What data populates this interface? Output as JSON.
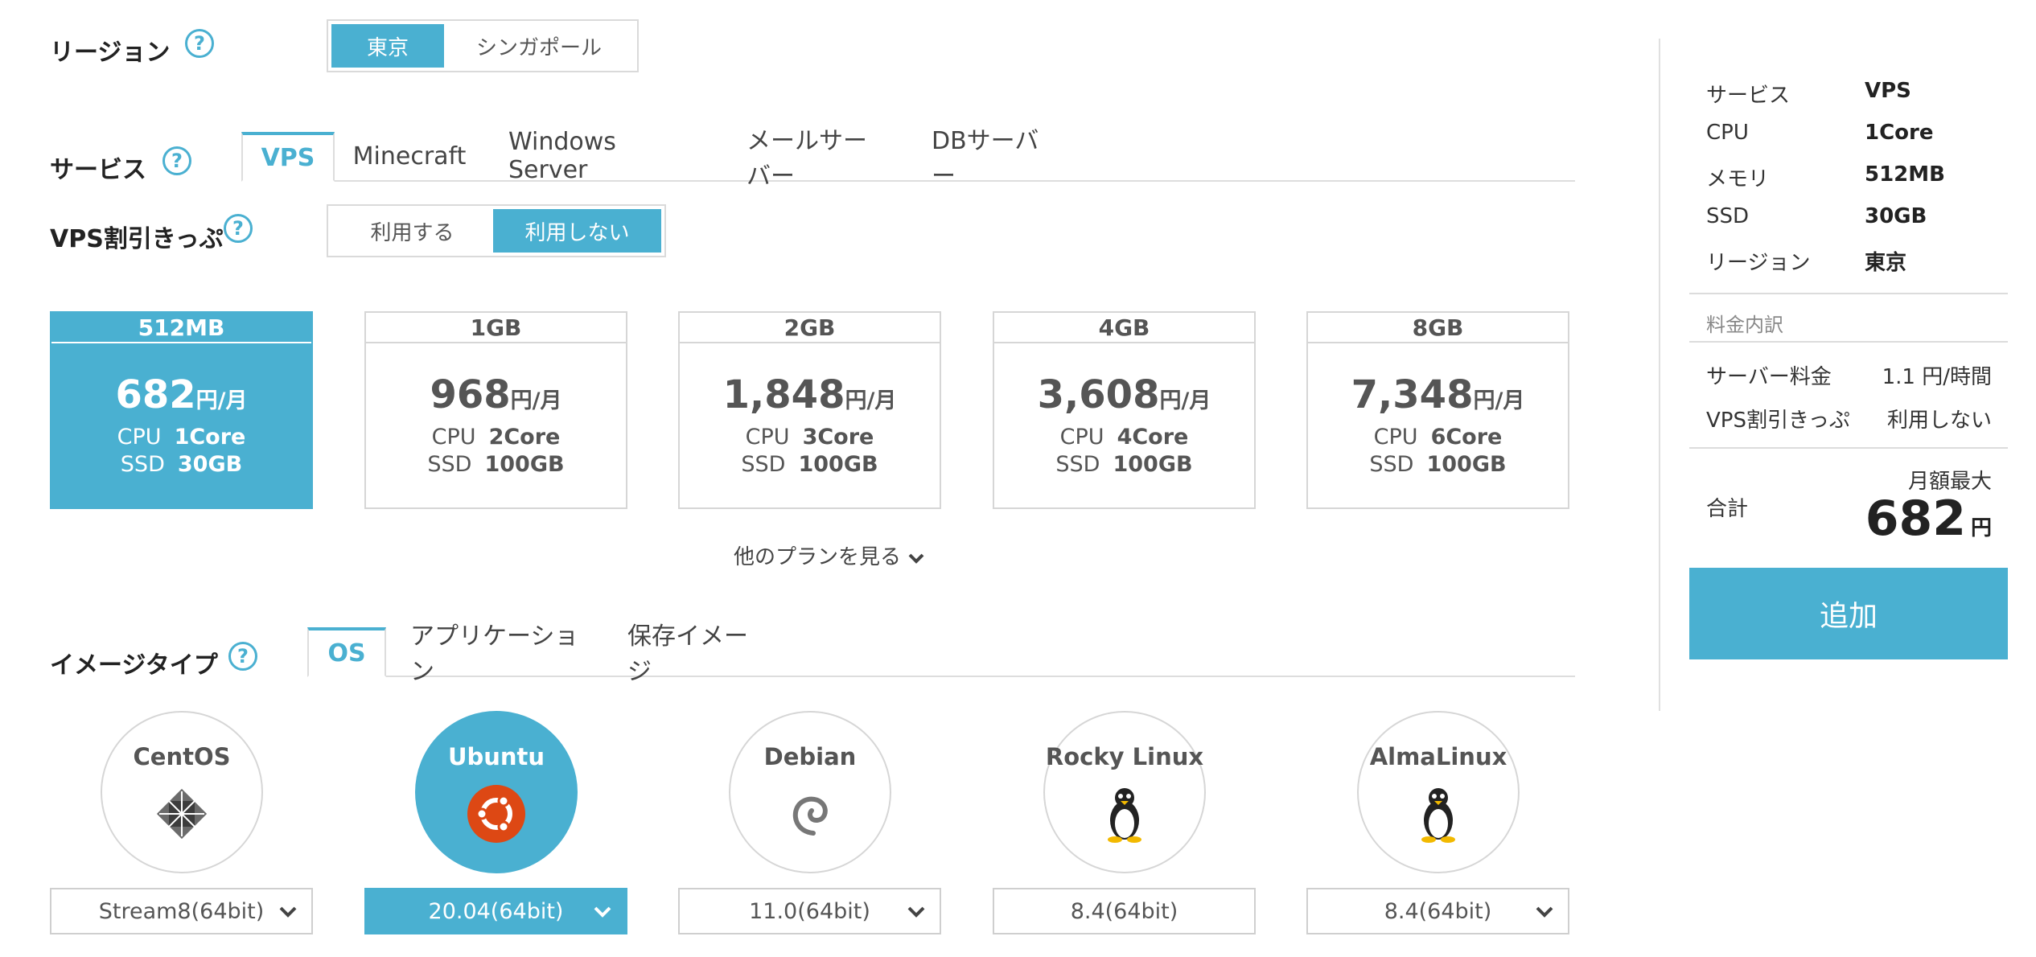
{
  "region": {
    "label": "リージョン",
    "help": "?",
    "options": [
      "東京",
      "シンガポール"
    ],
    "selected": "東京"
  },
  "service": {
    "label": "サービス",
    "help": "?",
    "tabs": [
      "VPS",
      "Minecraft",
      "Windows Server",
      "メールサーバー",
      "DBサーバー"
    ],
    "active_tab": "VPS"
  },
  "discount": {
    "label": "VPS割引きっぷ",
    "help": "?",
    "options": [
      "利用する",
      "利用しない"
    ],
    "selected": "利用しない"
  },
  "plans": [
    {
      "name": "512MB",
      "price": "682",
      "unit": "円/月",
      "cpu_label": "CPU",
      "cpu": "1Core",
      "ssd_label": "SSD",
      "ssd": "30GB",
      "active": true
    },
    {
      "name": "1GB",
      "price": "968",
      "unit": "円/月",
      "cpu_label": "CPU",
      "cpu": "2Core",
      "ssd_label": "SSD",
      "ssd": "100GB",
      "active": false
    },
    {
      "name": "2GB",
      "price": "1,848",
      "unit": "円/月",
      "cpu_label": "CPU",
      "cpu": "3Core",
      "ssd_label": "SSD",
      "ssd": "100GB",
      "active": false
    },
    {
      "name": "4GB",
      "price": "3,608",
      "unit": "円/月",
      "cpu_label": "CPU",
      "cpu": "4Core",
      "ssd_label": "SSD",
      "ssd": "100GB",
      "active": false
    },
    {
      "name": "8GB",
      "price": "7,348",
      "unit": "円/月",
      "cpu_label": "CPU",
      "cpu": "6Core",
      "ssd_label": "SSD",
      "ssd": "100GB",
      "active": false
    }
  ],
  "more_plans": "他のプランを見る",
  "image_type": {
    "label": "イメージタイプ",
    "help": "?",
    "tabs": [
      "OS",
      "アプリケーション",
      "保存イメージ"
    ],
    "active_tab": "OS"
  },
  "os_list": [
    {
      "name": "CentOS",
      "icon": "centos-icon",
      "version": "Stream8(64bit)",
      "dropdown": true,
      "active": false
    },
    {
      "name": "Ubuntu",
      "icon": "ubuntu-icon",
      "version": "20.04(64bit)",
      "dropdown": true,
      "active": true
    },
    {
      "name": "Debian",
      "icon": "debian-icon",
      "version": "11.0(64bit)",
      "dropdown": true,
      "active": false
    },
    {
      "name": "Rocky Linux",
      "icon": "tux-icon",
      "version": "8.4(64bit)",
      "dropdown": false,
      "active": false
    },
    {
      "name": "AlmaLinux",
      "icon": "tux-icon",
      "version": "8.4(64bit)",
      "dropdown": true,
      "active": false
    }
  ],
  "summary": {
    "rows": [
      {
        "label": "サービス",
        "value": "VPS"
      },
      {
        "label": "CPU",
        "value": "1Core"
      },
      {
        "label": "メモリ",
        "value": "512MB"
      },
      {
        "label": "SSD",
        "value": "30GB"
      },
      {
        "label": "リージョン",
        "value": "東京"
      }
    ],
    "breakdown_label": "料金内訳",
    "fees": [
      {
        "label": "サーバー料金",
        "value": "1.1 円/時間"
      },
      {
        "label": "VPS割引きっぷ",
        "value": "利用しない"
      }
    ],
    "total_label": "合計",
    "monthly_max": "月額最大",
    "total": "682",
    "total_unit": "円",
    "add_button": "追加"
  },
  "colors": {
    "accent": "#4ab0d1"
  }
}
